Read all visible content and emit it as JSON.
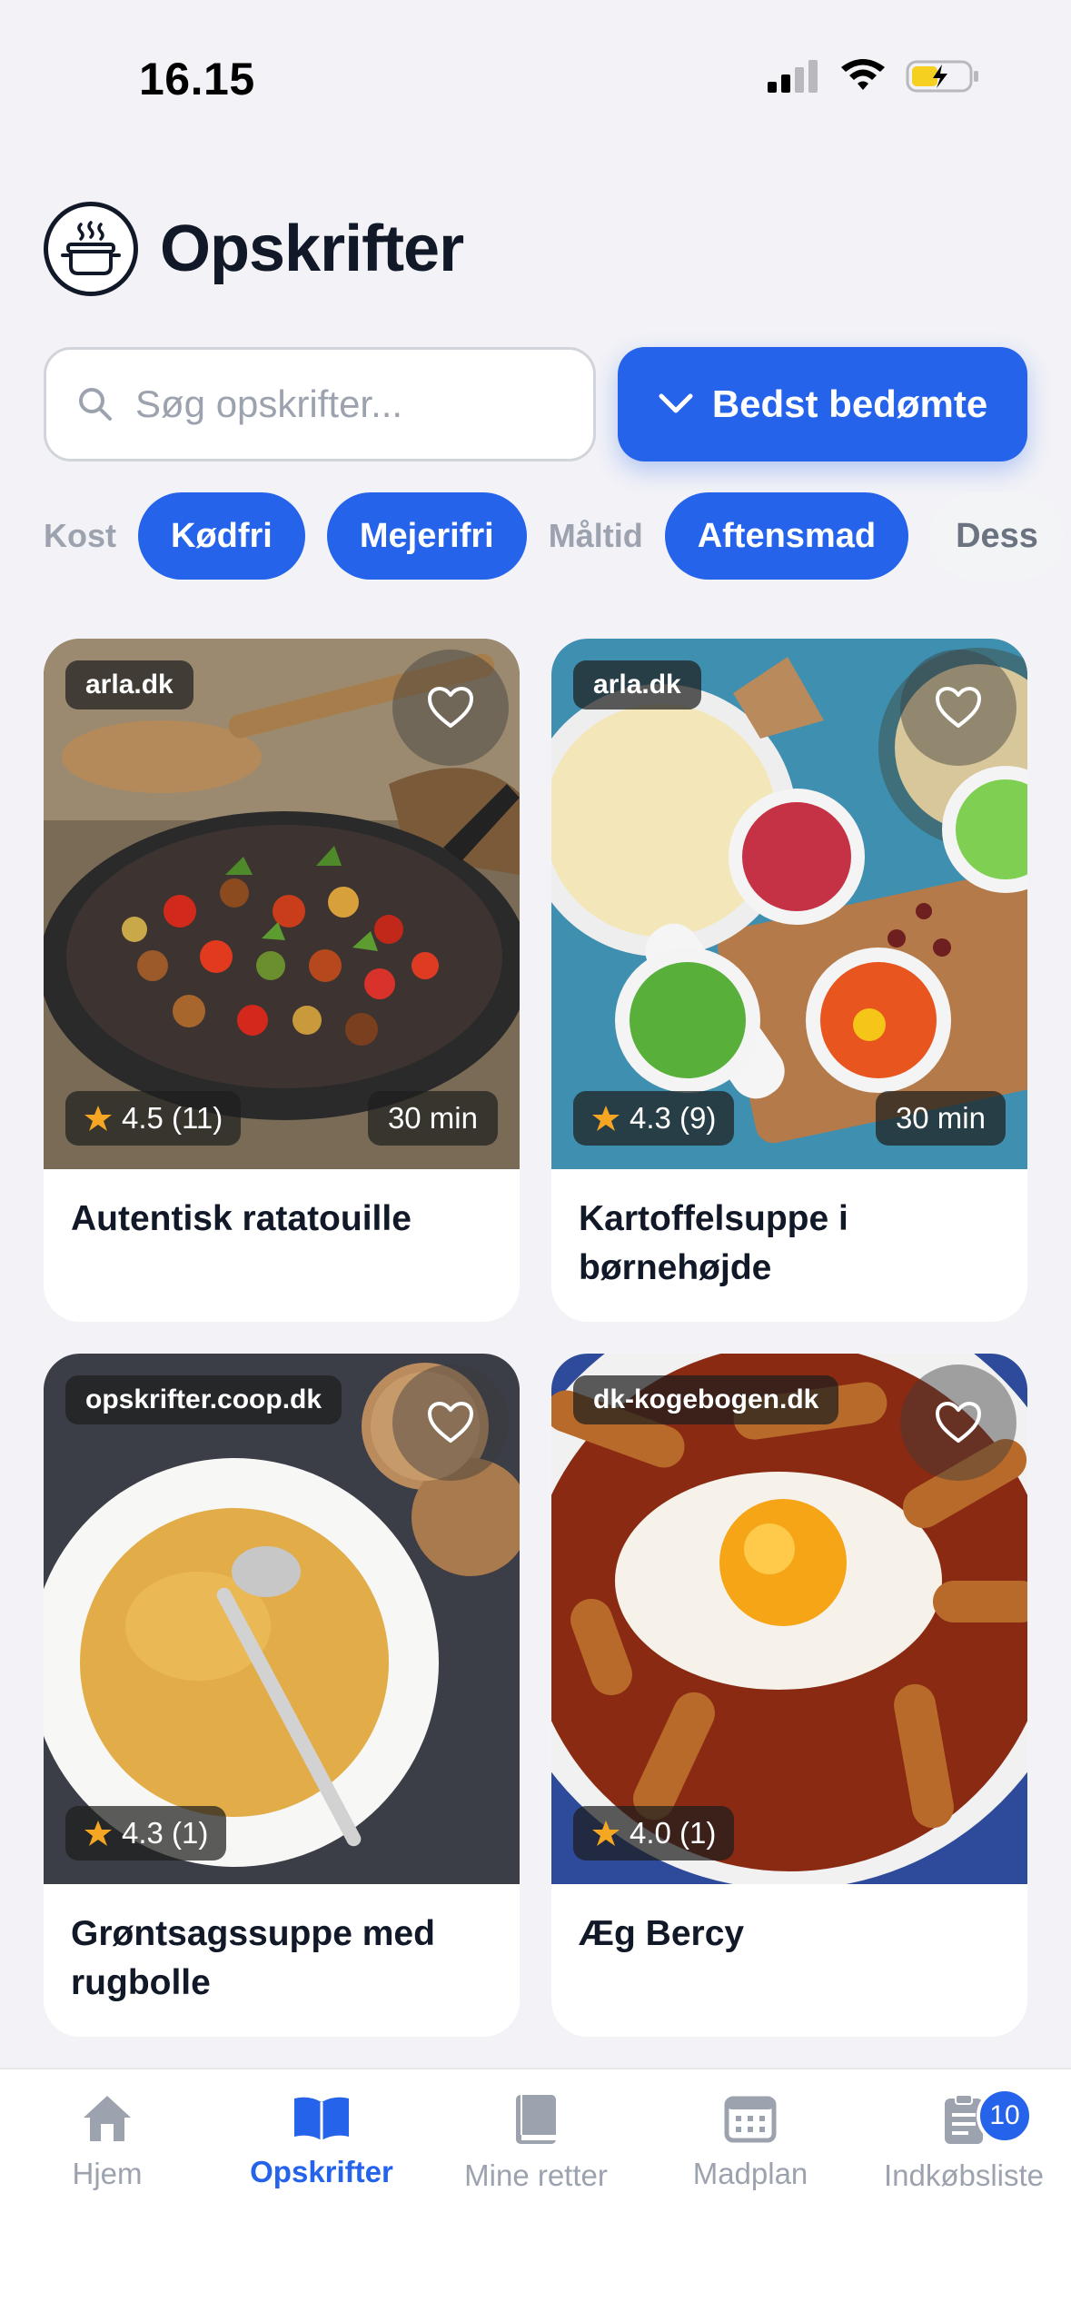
{
  "status_bar": {
    "time": "16.15"
  },
  "header": {
    "title": "Opskrifter",
    "logo_icon": "pot-icon"
  },
  "search": {
    "placeholder": "Søg opskrifter..."
  },
  "sort": {
    "label": "Bedst bedømte"
  },
  "filters": {
    "groups": [
      {
        "label": "Kost",
        "chips": [
          "Kødfri",
          "Mejerifri"
        ]
      },
      {
        "label": "Måltid",
        "chips": [
          "Aftensmad"
        ]
      }
    ],
    "partial_chip": "Dess"
  },
  "recipes": [
    {
      "source": "arla.dk",
      "rating": "4.5 (11)",
      "time": "30 min",
      "title": "Autentisk ratatouille"
    },
    {
      "source": "arla.dk",
      "rating": "4.3 (9)",
      "time": "30 min",
      "title": "Kartoffelsuppe i børnehøjde"
    },
    {
      "source": "opskrifter.coop.dk",
      "rating": "4.3 (1)",
      "time": "",
      "title": "Grøntsagssuppe med rugbolle"
    },
    {
      "source": "dk-kogebogen.dk",
      "rating": "4.0 (1)",
      "time": "",
      "title": "Æg Bercy"
    }
  ],
  "bottom_nav": {
    "items": [
      {
        "label": "Hjem",
        "icon": "home-icon"
      },
      {
        "label": "Opskrifter",
        "icon": "book-open-icon"
      },
      {
        "label": "Mine retter",
        "icon": "book-icon"
      },
      {
        "label": "Madplan",
        "icon": "calendar-icon"
      },
      {
        "label": "Indkøbsliste",
        "icon": "list-icon"
      }
    ],
    "active": "Opskrifter",
    "shopping_badge": "10"
  },
  "colors": {
    "accent": "#2563eb",
    "background": "#f2f2f7",
    "text": "#111827",
    "muted": "#9ca3af",
    "star": "#f5a623"
  }
}
